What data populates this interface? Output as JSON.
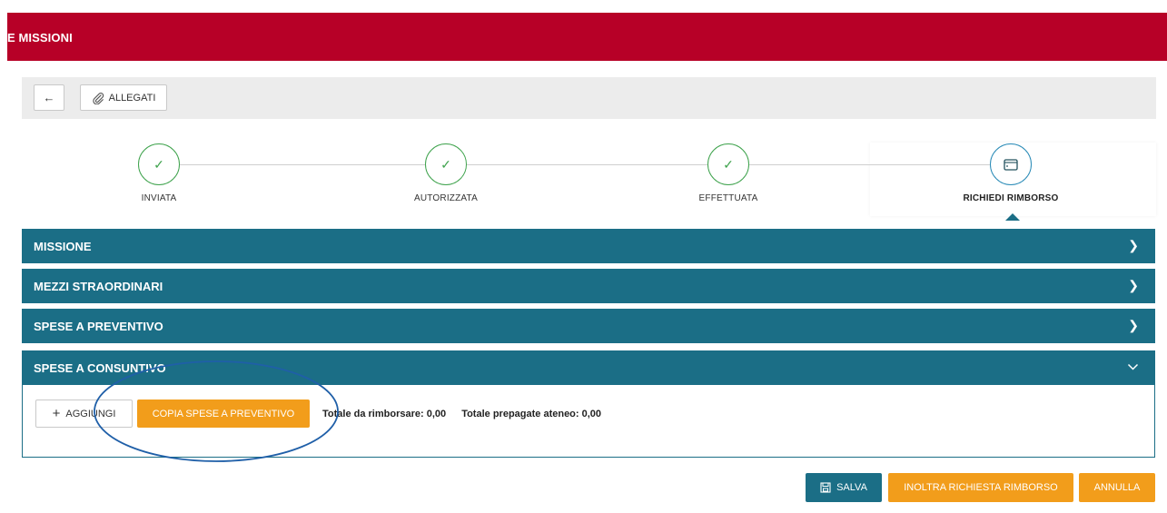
{
  "header": {
    "title": "E MISSIONI"
  },
  "toolbar": {
    "back_icon": "←",
    "attachments_label": "ALLEGATI"
  },
  "steps": [
    {
      "label": "INVIATA",
      "state": "done"
    },
    {
      "label": "AUTORIZZATA",
      "state": "done"
    },
    {
      "label": "EFFETTUATA",
      "state": "done"
    },
    {
      "label": "RICHIEDI RIMBORSO",
      "state": "active"
    }
  ],
  "panels": {
    "missione": "MISSIONE",
    "mezzi": "MEZZI STRAORDINARI",
    "spese_preventivo": "SPESE A PREVENTIVO",
    "spese_consuntivo": "SPESE A CONSUNTIVO"
  },
  "consuntivo": {
    "add_label": "AGGIUNGI",
    "copy_label": "COPIA SPESE A PREVENTIVO",
    "total_refund": "Totale da rimborsare: 0,00",
    "total_prepaid": "Totale prepagate ateneo: 0,00"
  },
  "footer": {
    "save_label": "SALVA",
    "forward_label": "INOLTRA RICHIESTA RIMBORSO",
    "cancel_label": "ANNULLA"
  },
  "colors": {
    "brand": "#b70027",
    "panel": "#1b6e86",
    "accent": "#f29d1b",
    "success": "#3fa34d",
    "highlight_ellipse": "#1f5fa8"
  }
}
